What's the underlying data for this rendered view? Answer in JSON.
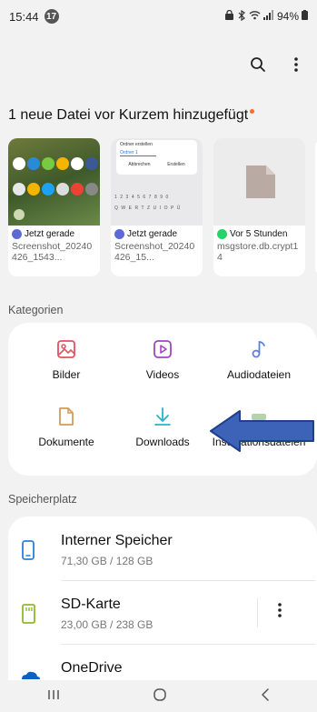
{
  "status_bar": {
    "time": "15:44",
    "notification_count": "17",
    "battery": "94%"
  },
  "recent": {
    "title": "1 neue Datei vor Kurzem hinzugefügt",
    "files": [
      {
        "time": "Jetzt gerade",
        "name": "Screenshot_20240426_1543...",
        "app_color": "#5b6ad6"
      },
      {
        "time": "Jetzt gerade",
        "name": "Screenshot_20240426_15...",
        "app_color": "#5b6ad6"
      },
      {
        "time": "Vor 5 Stunden",
        "name": "msgstore.db.crypt14",
        "app_color": "#25d366"
      }
    ],
    "dialog": {
      "title": "Ordner erstellen",
      "input": "Ordner 1",
      "cancel": "Abbrechen",
      "create": "Erstellen"
    },
    "keyboard_rows": [
      "1234567890",
      "QWERTZUIOPÜ"
    ]
  },
  "categories": {
    "label": "Kategorien",
    "items": [
      {
        "label": "Bilder",
        "icon": "image-icon"
      },
      {
        "label": "Videos",
        "icon": "video-icon"
      },
      {
        "label": "Audiodateien",
        "icon": "music-note-icon"
      },
      {
        "label": "Dokumente",
        "icon": "document-icon"
      },
      {
        "label": "Downloads",
        "icon": "download-icon"
      },
      {
        "label": "Installationsdateien",
        "icon": "apk-icon"
      }
    ],
    "colors": {
      "images": "#e0525f",
      "videos": "#a146c2",
      "audio": "#5b7fe0",
      "docs": "#d49a5a",
      "downloads": "#2db1c9",
      "apk": "#6aa84f"
    }
  },
  "storage": {
    "label": "Speicherplatz",
    "items": [
      {
        "name": "Interner Speicher",
        "size": "71,30 GB / 128 GB"
      },
      {
        "name": "SD-Karte",
        "size": "23,00 GB / 238 GB"
      },
      {
        "name": "OneDrive",
        "size": ""
      }
    ]
  },
  "annotation_arrow_color": "#3d63b8"
}
